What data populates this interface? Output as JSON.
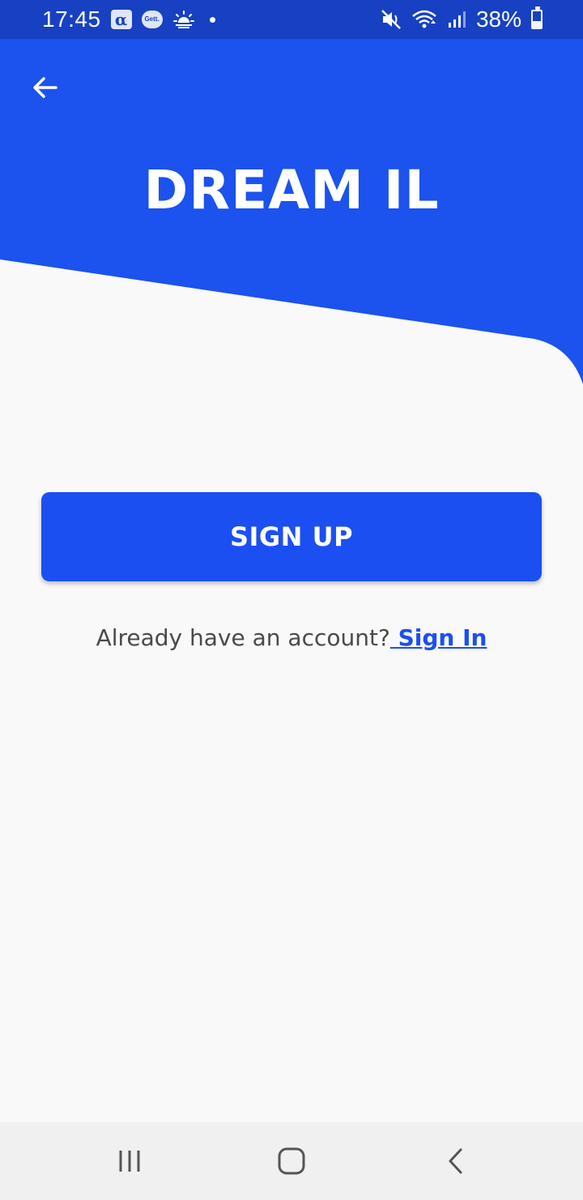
{
  "status_bar": {
    "time": "17:45",
    "battery_percent": "38%",
    "battery_level": 0.38,
    "notification_icons": [
      "alpha-icon",
      "gett-icon",
      "weather-sunrise-icon",
      "dot"
    ],
    "system_icons": [
      "mute-icon",
      "wifi-icon",
      "signal-icon",
      "battery-icon"
    ],
    "alpha_glyph": "α",
    "gett_label": "Gett."
  },
  "header": {
    "title": "DREAM IL",
    "back_icon": "arrow-left-icon",
    "background_color": "#1c52ed"
  },
  "main": {
    "signup_label": "SIGN UP",
    "account_prompt": "Already have an account?",
    "signin_label": " Sign In"
  },
  "nav_bar": {
    "buttons": [
      "recent-apps-icon",
      "home-icon",
      "back-icon"
    ]
  },
  "colors": {
    "accent": "#1c4ff1",
    "status_bar": "#1741c2",
    "background": "#f9f9f9"
  }
}
